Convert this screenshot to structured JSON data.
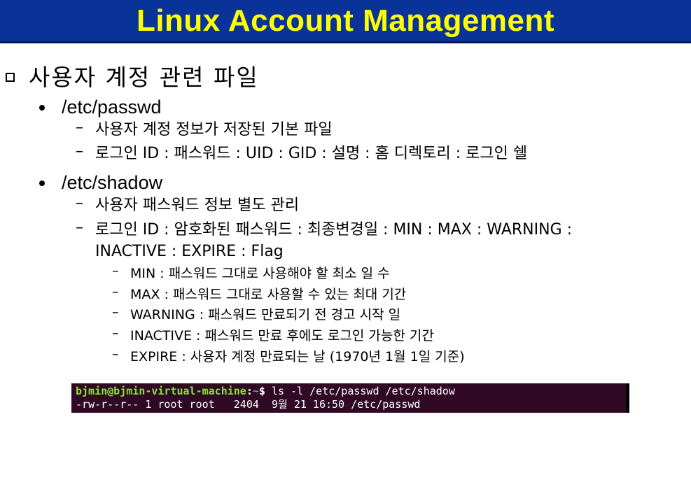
{
  "title": "Linux Account Management",
  "heading": "사용자 계정 관련 파일",
  "sections": [
    {
      "file": "/etc/passwd",
      "items": [
        "사용자 계정 정보가 저장된 기본 파일",
        "로그인 ID : 패스워드 : UID : GID : 설명 : 홈 디렉토리 : 로그인 쉘"
      ]
    },
    {
      "file": "/etc/shadow",
      "items": [
        "사용자 패스워드 정보 별도 관리",
        "로그인 ID : 암호화된 패스워드 : 최종변경일 : MIN : MAX : WARNING :",
        "INACTIVE : EXPIRE : Flag"
      ],
      "subitems": [
        "MIN : 패스워드 그대로 사용해야 할 최소 일 수",
        "MAX : 패스워드 그대로 사용할 수 있는 최대 기간",
        "WARNING : 패스워드 만료되기 전 경고 시작 일",
        "INACTIVE : 패스워드 만료 후에도 로그인 가능한 기간",
        "EXPIRE : 사용자 계정 만료되는 날 (1970년 1월 1일 기준)"
      ]
    }
  ],
  "terminal": {
    "prompt_user": "bjmin@bjmin-virtual-machine",
    "prompt_sep": ":",
    "prompt_path": "~",
    "prompt_symbol": "$",
    "command": " ls -l /etc/passwd /etc/shadow",
    "output_line": "-rw-r--r-- 1 root root   2404  9월 21 16:50 /etc/passwd"
  },
  "colors": {
    "title_bg": "#0a3399",
    "title_text": "#ffff00",
    "terminal_bg": "#300a24",
    "prompt_green": "#8ae234",
    "path_blue": "#729fcf"
  }
}
